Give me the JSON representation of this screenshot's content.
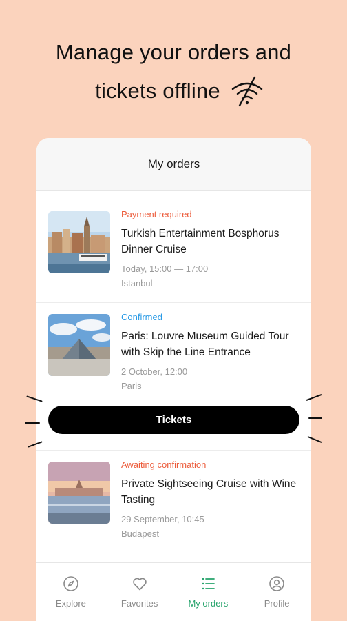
{
  "headline": {
    "line1": "Manage your orders and",
    "line2": "tickets offline",
    "icon": "wifi-off-icon"
  },
  "header": {
    "title": "My orders"
  },
  "orders": [
    {
      "status": "Payment required",
      "status_color": "#ec5b3a",
      "title": "Turkish Entertainment Bosphorus Dinner Cruise",
      "time": "Today, 15:00 — 17:00",
      "city": "Istanbul"
    },
    {
      "status": "Confirmed",
      "status_color": "#2b9be6",
      "title": "Paris: Louvre Museum Guided Tour with Skip the Line Entrance",
      "time": "2 October, 12:00",
      "city": "Paris"
    },
    {
      "status": "Awaiting confirmation",
      "status_color": "#ec5b3a",
      "title": "Private Sightseeing Cruise with Wine Tasting",
      "time": "29 September, 10:45",
      "city": "Budapest"
    }
  ],
  "tickets_button": {
    "label": "Tickets"
  },
  "tabbar": {
    "items": [
      {
        "label": "Explore",
        "icon": "compass-icon"
      },
      {
        "label": "Favorites",
        "icon": "heart-icon"
      },
      {
        "label": "My orders",
        "icon": "list-icon",
        "active": true
      },
      {
        "label": "Profile",
        "icon": "user-icon"
      }
    ],
    "active_color": "#25a36b"
  },
  "colors": {
    "background": "#fbd3bd",
    "button": "#000000"
  }
}
